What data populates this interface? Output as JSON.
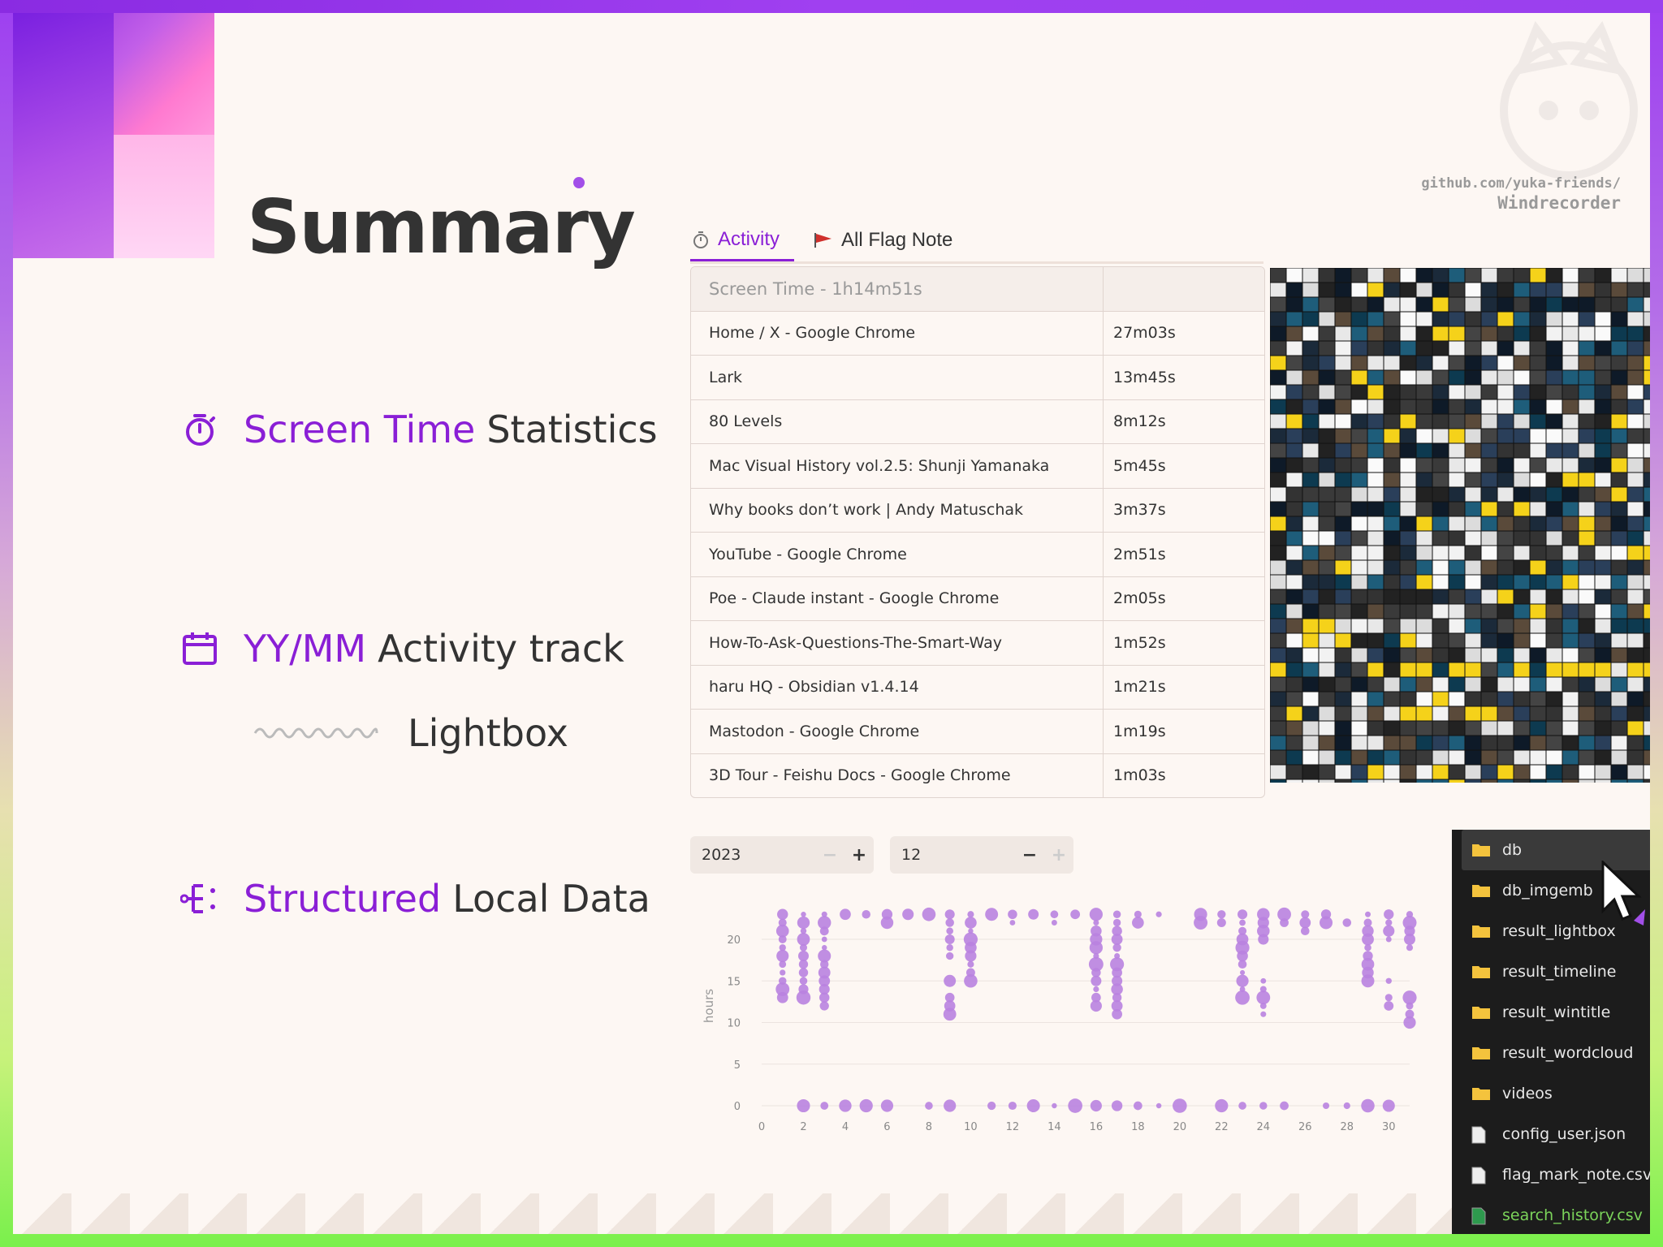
{
  "slide": {
    "title": "Summary",
    "github_line1": "github.com/yuka-friends/",
    "github_line2": "Windrecorder"
  },
  "features": [
    {
      "highlight": "Screen Time",
      "rest": "Statistics",
      "icon": "stopwatch-icon"
    },
    {
      "highlight": "YY/MM",
      "rest": "Activity track",
      "icon": "calendar-icon"
    },
    {
      "highlight": "Structured",
      "rest": "Local Data",
      "icon": "structure-icon"
    }
  ],
  "lightbox_label": "Lightbox",
  "tabs": [
    {
      "label": "Activity",
      "icon": "stopwatch-icon",
      "active": true
    },
    {
      "label": "All Flag Note",
      "icon": "flag-icon",
      "active": false
    }
  ],
  "table": {
    "header": "Screen Time - 1h14m51s",
    "header2": "",
    "rows": [
      {
        "name": "Home / X - Google Chrome",
        "time": "27m03s"
      },
      {
        "name": "Lark",
        "time": "13m45s"
      },
      {
        "name": "80 Levels",
        "time": "8m12s"
      },
      {
        "name": "Mac Visual History vol.2.5: Shunji Yamanaka",
        "time": "5m45s"
      },
      {
        "name": "Why books don’t work | Andy Matuschak",
        "time": "3m37s"
      },
      {
        "name": "YouTube - Google Chrome",
        "time": "2m51s"
      },
      {
        "name": "Poe - Claude instant - Google Chrome",
        "time": "2m05s"
      },
      {
        "name": "How-To-Ask-Questions-The-Smart-Way",
        "time": "1m52s"
      },
      {
        "name": "haru HQ - Obsidian v1.4.14",
        "time": "1m21s"
      },
      {
        "name": "Mastodon - Google Chrome",
        "time": "1m19s"
      },
      {
        "name": "3D Tour - Feishu Docs - Google Chrome",
        "time": "1m03s"
      }
    ]
  },
  "year_input": {
    "value": "2023",
    "minus": "−",
    "plus": "+"
  },
  "month_input": {
    "value": "12",
    "minus": "−",
    "plus": "+"
  },
  "chart_data": {
    "type": "scatter",
    "xlabel": "",
    "ylabel": "hours",
    "xlim": [
      0,
      31
    ],
    "ylim": [
      0,
      24
    ],
    "xticks": [
      0,
      2,
      4,
      6,
      8,
      10,
      12,
      14,
      16,
      18,
      20,
      22,
      24,
      26,
      28,
      30
    ],
    "yticks": [
      0,
      5,
      10,
      15,
      20
    ],
    "color": "#b982e0",
    "points_by_day": [
      {
        "day": 1,
        "hours": [
          13,
          14,
          15,
          16,
          17,
          18,
          19,
          20,
          21,
          22,
          23
        ]
      },
      {
        "day": 2,
        "hours": [
          0,
          13,
          14,
          15,
          16,
          17,
          18,
          19,
          20,
          21,
          22,
          23
        ]
      },
      {
        "day": 3,
        "hours": [
          0,
          12,
          13,
          14,
          15,
          16,
          17,
          18,
          19,
          20,
          21,
          22,
          23
        ]
      },
      {
        "day": 4,
        "hours": [
          0,
          23
        ]
      },
      {
        "day": 5,
        "hours": [
          0,
          23
        ]
      },
      {
        "day": 6,
        "hours": [
          0,
          22,
          23
        ]
      },
      {
        "day": 7,
        "hours": [
          23
        ]
      },
      {
        "day": 8,
        "hours": [
          0,
          23
        ]
      },
      {
        "day": 9,
        "hours": [
          0,
          11,
          12,
          13,
          15,
          18,
          19,
          20,
          21,
          22,
          23
        ]
      },
      {
        "day": 10,
        "hours": [
          15,
          16,
          17,
          18,
          19,
          20,
          21,
          22,
          23
        ]
      },
      {
        "day": 11,
        "hours": [
          0,
          23
        ]
      },
      {
        "day": 12,
        "hours": [
          0,
          22,
          23
        ]
      },
      {
        "day": 13,
        "hours": [
          0,
          23
        ]
      },
      {
        "day": 14,
        "hours": [
          0,
          22,
          23
        ]
      },
      {
        "day": 15,
        "hours": [
          0,
          23
        ]
      },
      {
        "day": 16,
        "hours": [
          0,
          12,
          13,
          14,
          15,
          16,
          17,
          18,
          19,
          20,
          21,
          22,
          23
        ]
      },
      {
        "day": 17,
        "hours": [
          0,
          11,
          12,
          13,
          14,
          15,
          16,
          17,
          18,
          19,
          20,
          21,
          22,
          23
        ]
      },
      {
        "day": 18,
        "hours": [
          0,
          22,
          23
        ]
      },
      {
        "day": 19,
        "hours": [
          0,
          23
        ]
      },
      {
        "day": 20,
        "hours": [
          0
        ]
      },
      {
        "day": 21,
        "hours": [
          22,
          23
        ]
      },
      {
        "day": 22,
        "hours": [
          0,
          22,
          23
        ]
      },
      {
        "day": 23,
        "hours": [
          0,
          13,
          14,
          15,
          16,
          17,
          18,
          19,
          20,
          21,
          22,
          23
        ]
      },
      {
        "day": 24,
        "hours": [
          0,
          11,
          12,
          13,
          14,
          15,
          20,
          21,
          22,
          23
        ]
      },
      {
        "day": 25,
        "hours": [
          0,
          22,
          23
        ]
      },
      {
        "day": 26,
        "hours": [
          21,
          22,
          23
        ]
      },
      {
        "day": 27,
        "hours": [
          0,
          22,
          23
        ]
      },
      {
        "day": 28,
        "hours": [
          0,
          22
        ]
      },
      {
        "day": 29,
        "hours": [
          0,
          15,
          16,
          17,
          18,
          19,
          20,
          21,
          22,
          23
        ]
      },
      {
        "day": 30,
        "hours": [
          0,
          12,
          13,
          15,
          20,
          21,
          22,
          23
        ]
      },
      {
        "day": 31,
        "hours": [
          10,
          11,
          12,
          13,
          19,
          20,
          21,
          22,
          23
        ]
      }
    ]
  },
  "files": [
    {
      "name": "db",
      "type": "folder"
    },
    {
      "name": "db_imgemb",
      "type": "folder"
    },
    {
      "name": "result_lightbox",
      "type": "folder"
    },
    {
      "name": "result_timeline",
      "type": "folder"
    },
    {
      "name": "result_wintitle",
      "type": "folder"
    },
    {
      "name": "result_wordcloud",
      "type": "folder"
    },
    {
      "name": "videos",
      "type": "folder"
    },
    {
      "name": "config_user.json",
      "type": "file"
    },
    {
      "name": "flag_mark_note.csv",
      "type": "file"
    },
    {
      "name": "search_history.csv",
      "type": "file-green"
    }
  ],
  "colors": {
    "accent": "#8a1fd6",
    "paper": "#fdf7f3",
    "dot": "#b982e0"
  }
}
